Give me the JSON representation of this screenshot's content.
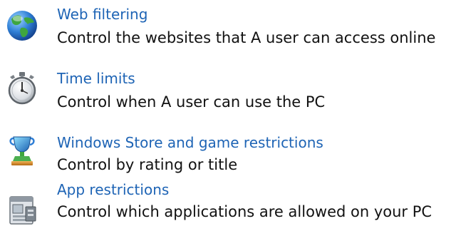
{
  "items": [
    {
      "title": "Web filtering",
      "description": "Control the websites that A user can access online",
      "icon": "globe-icon"
    },
    {
      "title": "Time limits",
      "description": "Control when A user can use the PC",
      "icon": "stopwatch-icon"
    },
    {
      "title": "Windows Store and game restrictions",
      "description": "Control by rating or title",
      "icon": "trophy-icon"
    },
    {
      "title": "App restrictions",
      "description": "Control which applications are allowed on your PC",
      "icon": "app-window-icon"
    }
  ],
  "colors": {
    "link": "#1e64b5",
    "text": "#111111",
    "background": "#ffffff"
  }
}
